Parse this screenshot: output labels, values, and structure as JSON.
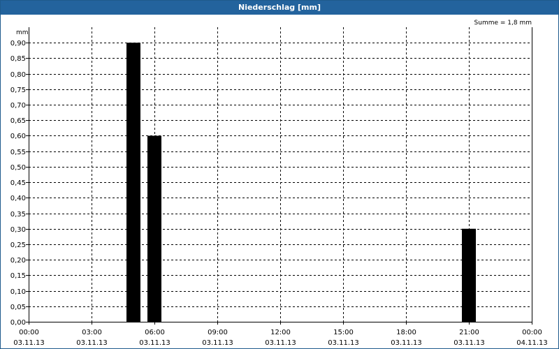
{
  "window": {
    "title": "Niederschlag [mm]"
  },
  "chart_data": {
    "type": "bar",
    "title": "Niederschlag [mm]",
    "unit_label": "mm",
    "annotation": "Summe = 1,8 mm",
    "ylim": [
      0,
      0.95
    ],
    "y_ticks": [
      "0,00",
      "0,05",
      "0,10",
      "0,15",
      "0,20",
      "0,25",
      "0,30",
      "0,35",
      "0,40",
      "0,45",
      "0,50",
      "0,55",
      "0,60",
      "0,65",
      "0,70",
      "0,75",
      "0,80",
      "0,85",
      "0,90"
    ],
    "y_tick_values": [
      0,
      0.05,
      0.1,
      0.15,
      0.2,
      0.25,
      0.3,
      0.35,
      0.4,
      0.45,
      0.5,
      0.55,
      0.6,
      0.65,
      0.7,
      0.75,
      0.8,
      0.85,
      0.9
    ],
    "x_range_hours": [
      0,
      24
    ],
    "x_ticks": [
      {
        "hour": 0,
        "time": "00:00",
        "date": "03.11.13"
      },
      {
        "hour": 3,
        "time": "03:00",
        "date": "03.11.13"
      },
      {
        "hour": 6,
        "time": "06:00",
        "date": "03.11.13"
      },
      {
        "hour": 9,
        "time": "09:00",
        "date": "03.11.13"
      },
      {
        "hour": 12,
        "time": "12:00",
        "date": "03.11.13"
      },
      {
        "hour": 15,
        "time": "15:00",
        "date": "03.11.13"
      },
      {
        "hour": 18,
        "time": "18:00",
        "date": "03.11.13"
      },
      {
        "hour": 21,
        "time": "21:00",
        "date": "03.11.13"
      },
      {
        "hour": 24,
        "time": "00:00",
        "date": "04.11.13"
      }
    ],
    "bars": [
      {
        "hour": 5,
        "value": 0.9
      },
      {
        "hour": 6,
        "value": 0.6
      },
      {
        "hour": 21,
        "value": 0.3
      }
    ],
    "bar_color": "#000000",
    "grid": true
  }
}
